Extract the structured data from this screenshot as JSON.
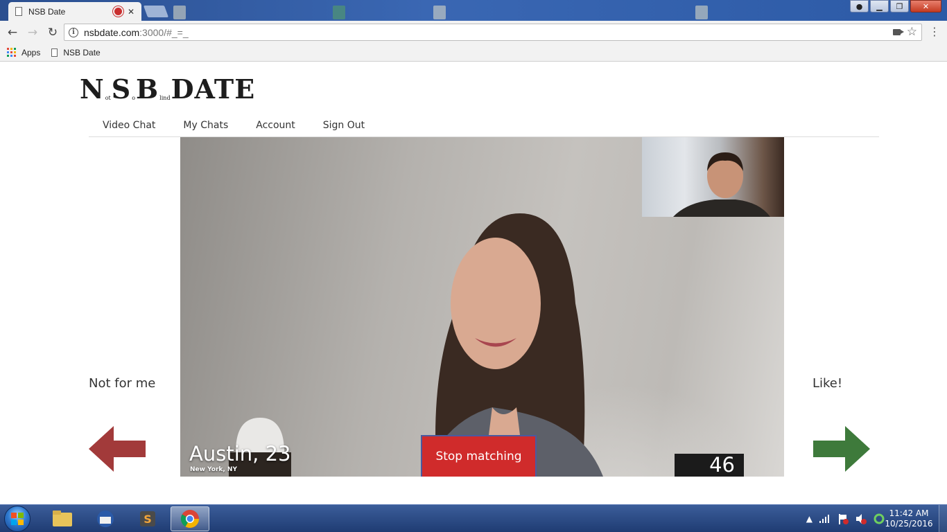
{
  "browser": {
    "tab_title": "NSB Date",
    "tab_close": "✕",
    "url_host": "nsbdate.com",
    "url_rest": ":3000/#_=_",
    "bookmarks": [
      {
        "label": "Apps",
        "icon": "apps-grid-icon"
      },
      {
        "label": "NSB Date",
        "icon": "page-icon"
      }
    ],
    "icons": {
      "back": "←",
      "forward": "→",
      "reload": "↻",
      "star": "☆",
      "menu": "⋮",
      "minimize": "▁",
      "maximize": "❐",
      "close": "✕"
    }
  },
  "site": {
    "logo": {
      "letters": [
        "N",
        "S",
        "B",
        "DATE"
      ],
      "small_after_n": "ot",
      "small_after_s": "o",
      "small_after_b": "lind"
    },
    "nav": [
      "Video Chat",
      "My Chats",
      "Account",
      "Sign Out"
    ],
    "left_label": "Not for me",
    "right_label": "Like!",
    "match": {
      "name_age": "Austin, 23",
      "location": "New York, NY",
      "stop_button": "Stop matching",
      "counter": "46"
    }
  },
  "taskbar": {
    "time": "11:42 AM",
    "date": "10/25/2016"
  },
  "colors": {
    "dislike_arrow": "#a23a3a",
    "like_arrow": "#3e7a3b",
    "stop_button": "#d02b2b"
  }
}
